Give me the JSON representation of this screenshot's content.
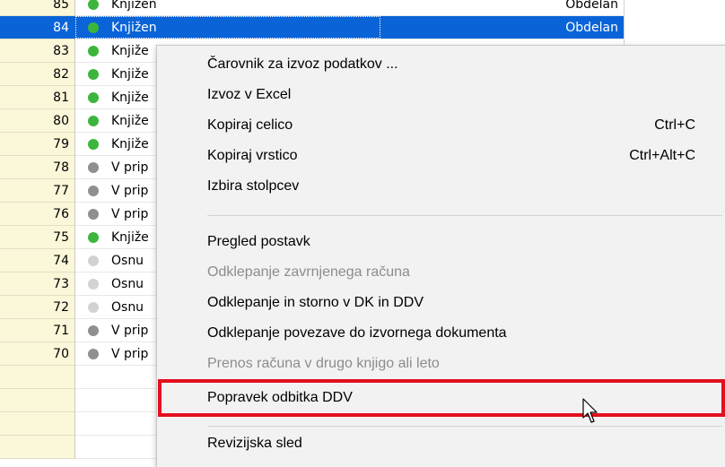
{
  "rows": [
    {
      "num": "85",
      "status": "Knjižen",
      "processed": "Obdelan",
      "dot": "green"
    },
    {
      "num": "84",
      "status": "Knjižen",
      "processed": "Obdelan",
      "dot": "green",
      "selected": true
    },
    {
      "num": "83",
      "status": "Knjiže",
      "processed": "",
      "dot": "green"
    },
    {
      "num": "82",
      "status": "Knjiže",
      "processed": "",
      "dot": "green"
    },
    {
      "num": "81",
      "status": "Knjiže",
      "processed": "",
      "dot": "green"
    },
    {
      "num": "80",
      "status": "Knjiže",
      "processed": "",
      "dot": "green"
    },
    {
      "num": "79",
      "status": "Knjiže",
      "processed": "",
      "dot": "green"
    },
    {
      "num": "78",
      "status": "V prip",
      "processed": "",
      "dot": "gray"
    },
    {
      "num": "77",
      "status": "V prip",
      "processed": "",
      "dot": "gray"
    },
    {
      "num": "76",
      "status": "V prip",
      "processed": "",
      "dot": "gray"
    },
    {
      "num": "75",
      "status": "Knjiže",
      "processed": "",
      "dot": "green"
    },
    {
      "num": "74",
      "status": "Osnu",
      "processed": "",
      "dot": "light"
    },
    {
      "num": "73",
      "status": "Osnu",
      "processed": "",
      "dot": "light"
    },
    {
      "num": "72",
      "status": "Osnu",
      "processed": "",
      "dot": "light"
    },
    {
      "num": "71",
      "status": "V prip",
      "processed": "",
      "dot": "gray"
    },
    {
      "num": "70",
      "status": "V prip",
      "processed": "",
      "dot": "gray"
    }
  ],
  "dot_colors": {
    "green": "#3cb53c",
    "gray": "#8f8f8f",
    "light": "#d2d2d2"
  },
  "menu": {
    "items": [
      {
        "label": "Čarovnik za izvoz podatkov ...",
        "shortcut": "",
        "disabled": false
      },
      {
        "label": "Izvoz v Excel",
        "shortcut": "",
        "disabled": false
      },
      {
        "label": "Kopiraj celico",
        "shortcut": "Ctrl+C",
        "disabled": false
      },
      {
        "label": "Kopiraj vrstico",
        "shortcut": "Ctrl+Alt+C",
        "disabled": false
      },
      {
        "label": "Izbira stolpcev",
        "shortcut": "",
        "disabled": false
      },
      {
        "label": "Pregled postavk",
        "shortcut": "",
        "disabled": false
      },
      {
        "label": "Odklepanje zavrnjenega računa",
        "shortcut": "",
        "disabled": true
      },
      {
        "label": "Odklepanje in storno v DK in DDV",
        "shortcut": "",
        "disabled": false
      },
      {
        "label": "Odklepanje povezave do izvornega dokumenta",
        "shortcut": "",
        "disabled": false
      },
      {
        "label": "Prenos računa v drugo knjigo ali leto",
        "shortcut": "",
        "disabled": true
      },
      {
        "label": "Popravek odbitka DDV",
        "shortcut": "",
        "disabled": false,
        "highlighted": true
      },
      {
        "label": "Revizijska sled",
        "shortcut": "",
        "disabled": false
      }
    ]
  },
  "highlight_color": "#e3101d"
}
